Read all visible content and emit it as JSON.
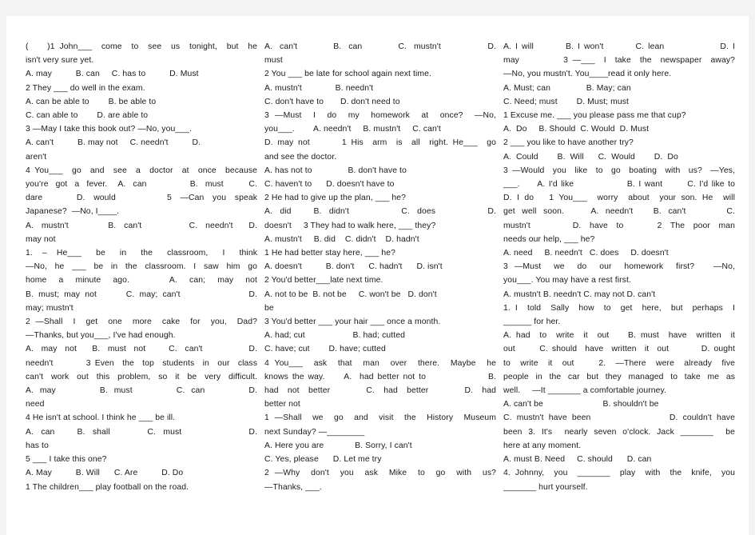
{
  "document": {
    "title": "Modal Verbs Multiple-Choice Exercise Worksheet",
    "background_color": "#f3f3f3",
    "page_color": "#ffffff",
    "text_color": "#1a1a1a",
    "column_count": 3
  },
  "columns": [
    {
      "id": "column-1",
      "lines": [
        {
          "text": "(    )1 John___  come  to  see  us  tonight,  but  he",
          "justified": true
        },
        {
          "text": "isn't very sure yet.",
          "justified": false
        },
        {
          "text": "A. may          B. can     C. has to          D. Must",
          "justified": false
        },
        {
          "text": "2 They ___ do well in the exam.",
          "justified": false
        },
        {
          "text": "A. can be able to        B. be able to",
          "justified": false
        },
        {
          "text": "C. can able to        D. are able to",
          "justified": false
        },
        {
          "text": "3 —May I take this book out? —No, you___.",
          "justified": false
        },
        {
          "text": "A. can't          B. may not     C. needn't          D.",
          "justified": false
        },
        {
          "text": "aren't",
          "justified": false
        },
        {
          "text": "4 You___  go  and  see  a  doctor  at  once  because",
          "justified": true
        },
        {
          "text": "you're  got  a  fever.   A.  can            B.  must       C.",
          "justified": true
        },
        {
          "text": "dare        D.  would            5  —Can  you  speak",
          "justified": true
        },
        {
          "text": "Japanese?  —No, I____.",
          "justified": false
        },
        {
          "text": "A.  mustn't          B.  can't            C.  needn't    D.",
          "justified": true
        },
        {
          "text": "may not",
          "justified": false
        },
        {
          "text": "1.  –  He___   be   in   the   classroom,   I   think",
          "justified": true
        },
        {
          "text": "—No,  he  ___  be  in  the  classroom.  I  saw  him  go",
          "justified": true
        },
        {
          "text": "home   a   minute   ago.          A.   can;   may   not",
          "justified": true
        },
        {
          "text": "B. must; may not      C. may; can't              D.",
          "justified": true
        },
        {
          "text": "may; mustn't",
          "justified": false
        },
        {
          "text": "2 —Shall  I  get  one  more  cake  for  you,  Dad?",
          "justified": true
        },
        {
          "text": "—Thanks, but you___, I've had enough.",
          "justified": false
        },
        {
          "text": "A.  may  not    B.  must  not      C.  can't            D.",
          "justified": true
        },
        {
          "text": "needn't        3 Even  the  top  students  in  our  class",
          "justified": true
        },
        {
          "text": "can't work out this problem, so it be very difficult.",
          "justified": true
        },
        {
          "text": "A.  may              B.  must              C.  can              D.",
          "justified": true
        },
        {
          "text": "need",
          "justified": false
        },
        {
          "text": "4 He isn't at school. I think he ___ be ill.",
          "justified": false
        },
        {
          "text": "A.  can      B.  shall          C.  must                  D.",
          "justified": true
        },
        {
          "text": "has to",
          "justified": false
        },
        {
          "text": "5 ___ I take this one?",
          "justified": false
        },
        {
          "text": "A. May          B. Will      C. Are          D. Do",
          "justified": false
        },
        {
          "text": "1 The children___ play football on the road.",
          "justified": false
        }
      ]
    },
    {
      "id": "column-2",
      "lines": [
        {
          "text": "A.  can't          B.  can          C.  mustn't             D.",
          "justified": true
        },
        {
          "text": "must",
          "justified": false
        },
        {
          "text": "2 You ___ be late for school again next time.",
          "justified": false
        },
        {
          "text": "A. mustn't              B. needn't",
          "justified": false
        },
        {
          "text": "C. don't have to       D. don't need to",
          "justified": false
        },
        {
          "text": "3 —Must  I  do  my  homework  at  once?  —No,",
          "justified": true
        },
        {
          "text": "you___.        A. needn't     B. mustn't     C. can't",
          "justified": false
        },
        {
          "text": "D. may not       1 His  arm  is  all  right. He___  go",
          "justified": true
        },
        {
          "text": "and see the doctor.",
          "justified": false
        },
        {
          "text": "A. has not to               B. don't have to",
          "justified": false
        },
        {
          "text": "C. haven't to      D. doesn't have to",
          "justified": false
        },
        {
          "text": "2 He had to give up the plan, ___ he?",
          "justified": false
        },
        {
          "text": "A.  did      B.  didn't              C.  does              D.",
          "justified": true
        },
        {
          "text": "doesn't     3 They had to walk here, ___ they?",
          "justified": false
        },
        {
          "text": "A. mustn't     B. did    C. didn't    D. hadn't",
          "justified": false
        },
        {
          "text": "1 He had better stay here, ___ he?",
          "justified": false
        },
        {
          "text": "A. doesn't          B. don't      C. hadn't      D. isn't",
          "justified": false
        },
        {
          "text": "2 You'd better___late next time.",
          "justified": false
        },
        {
          "text": "A. not to be  B. not be     C. won't be   D. don't",
          "justified": false
        },
        {
          "text": "be",
          "justified": false
        },
        {
          "text": "3 You'd better ___ your hair ___ once a month.",
          "justified": false
        },
        {
          "text": "A. had; cut                    B. had; cutted",
          "justified": false
        },
        {
          "text": "C. have; cut        D. have; cutted",
          "justified": false
        },
        {
          "text": "4 You___  ask  that  man  over  there.  Maybe  he",
          "justified": true
        },
        {
          "text": "knows the way.     A.  had better not to                B.",
          "justified": true
        },
        {
          "text": "had  not  better        C.  had  better        D.  had",
          "justified": true
        },
        {
          "text": "better not",
          "justified": false
        },
        {
          "text": "1 —Shall  we  go  and  visit  the  History  Museum",
          "justified": true
        },
        {
          "text": "next Sunday? —________",
          "justified": false
        },
        {
          "text": "A. Here you are             B. Sorry, I can't",
          "justified": false
        },
        {
          "text": "C. Yes, please      D. Let me try",
          "justified": false
        },
        {
          "text": "2 —Why  don't  you  ask  Mike  to  go  with  us?",
          "justified": true
        },
        {
          "text": "—Thanks, ___.",
          "justified": false
        }
      ]
    },
    {
      "id": "column-3",
      "lines": [
        {
          "text": "A. I will        B. I won't        C. lean              D. I",
          "justified": true
        },
        {
          "text": "may          3 —___  I  take  the  newspaper  away?",
          "justified": true
        },
        {
          "text": "—No, you mustn't. You____read it only here.",
          "justified": false
        },
        {
          "text": "A. Must; can               B. May; can",
          "justified": false
        },
        {
          "text": "C. Need; must        D. Must; must",
          "justified": false
        },
        {
          "text": "1 Excuse me. ___ you please pass me that cup?",
          "justified": false
        },
        {
          "text": "A.  Do     B. Should  C. Would  D. Must",
          "justified": false
        },
        {
          "text": "2 ___ you like to have another try?",
          "justified": false
        },
        {
          "text": "A.  Could        B.  Will      C.  Would        D.  Do",
          "justified": false
        },
        {
          "text": "3 —Would  you  like  to  go  boating  with  us?  —Yes,",
          "justified": true
        },
        {
          "text": "___.     A. I'd like               B. I want       C. I'd like to",
          "justified": true
        },
        {
          "text": "D. I do   1 You___  worry  about  your son. He  will",
          "justified": true
        },
        {
          "text": "get  well  soon.        A.  needn't      B.  can't            C.",
          "justified": true
        },
        {
          "text": "mustn't          D.  have  to        2  The  poor  man",
          "justified": true
        },
        {
          "text": "needs our help, ___ he?",
          "justified": false
        },
        {
          "text": "A. need     B. needn't   C. does     D. doesn't",
          "justified": false
        },
        {
          "text": "3 —Must  we  do  our  homework  first?   —No,",
          "justified": true
        },
        {
          "text": "you___. You may have a rest first.",
          "justified": false
        },
        {
          "text": "A. mustn't B. needn't C. may not D. can't",
          "justified": false
        },
        {
          "text": "1. I  told  Sally  how  to  get  here,  but  perhaps  I",
          "justified": true
        },
        {
          "text": "______ for her.",
          "justified": false
        },
        {
          "text": "A. had  to  write  it  out    B. must  have  written  it",
          "justified": true
        },
        {
          "text": "out      C. should  have  written  it  out        D. ought",
          "justified": true
        },
        {
          "text": "to  write  it  out     2.  —There  were  already  five",
          "justified": true
        },
        {
          "text": "people in the car but they managed to take me as",
          "justified": true
        },
        {
          "text": "well.     —It _______ a comfortable journey.",
          "justified": false
        },
        {
          "text": "A. can't be                         B. shouldn't be",
          "justified": false
        },
        {
          "text": "C. mustn't have been                D. couldn't have",
          "justified": true
        },
        {
          "text": "been 3. It's  nearly seven o'clock. Jack _______  be",
          "justified": true
        },
        {
          "text": "here at any moment.",
          "justified": false
        },
        {
          "text": "A. must B. Need     C. should      D. can",
          "justified": false
        },
        {
          "text": "4. Johnny,  you  _______  play  with  the  knife,  you",
          "justified": true
        },
        {
          "text": "_______ hurt yourself.",
          "justified": false
        }
      ]
    }
  ]
}
